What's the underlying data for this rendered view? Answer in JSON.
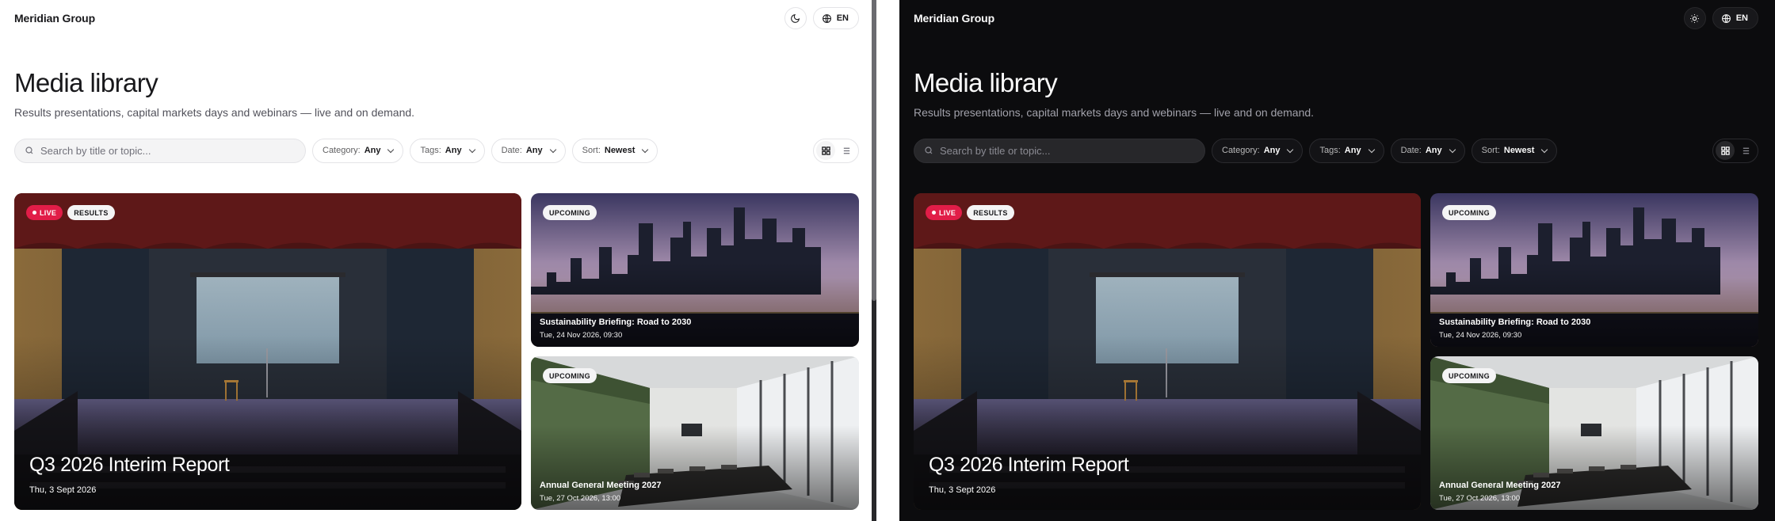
{
  "brand": "Meridian Group",
  "language": "EN",
  "page": {
    "title": "Media library",
    "subtitle": "Results presentations, capital markets days and webinars — live and on demand."
  },
  "search": {
    "placeholder": "Search by title or topic..."
  },
  "filters": [
    {
      "key": "Category:",
      "value": "Any"
    },
    {
      "key": "Tags:",
      "value": "Any"
    },
    {
      "key": "Date:",
      "value": "Any"
    },
    {
      "key": "Sort:",
      "value": "Newest"
    }
  ],
  "view_modes": [
    "grid",
    "list"
  ],
  "featured": {
    "live_label": "LIVE",
    "tag": "RESULTS",
    "title": "Q3 2026 Interim Report",
    "date": "Thu, 3 Sept 2026"
  },
  "upcoming": [
    {
      "badge": "UPCOMING",
      "title": "Sustainability Briefing: Road to 2030",
      "date": "Tue, 24 Nov 2026, 09:30"
    },
    {
      "badge": "UPCOMING",
      "title": "Annual General Meeting 2027",
      "date": "Tue, 27 Oct 2026, 13:00"
    }
  ],
  "colors": {
    "live": "#e11d48",
    "light_bg": "#ffffff",
    "dark_bg": "#0c0c0e"
  }
}
